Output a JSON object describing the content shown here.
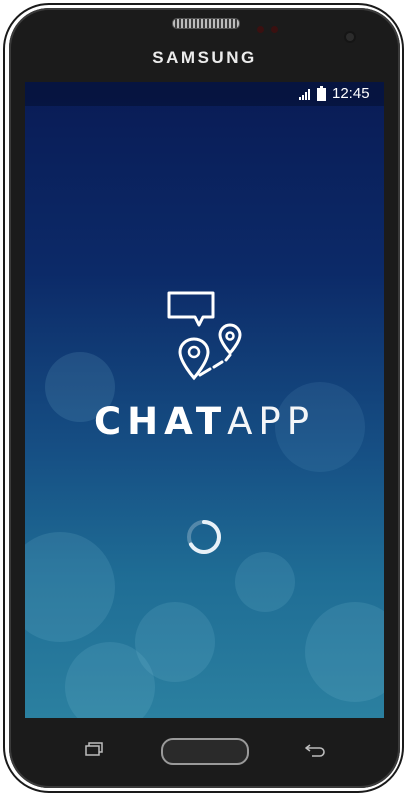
{
  "device": {
    "brand": "SAMSUNG"
  },
  "status_bar": {
    "time": "12:45",
    "icons": [
      "signal-icon",
      "battery-icon"
    ]
  },
  "splash": {
    "app_name_bold": "CHAT",
    "app_name_light": "APP",
    "logo_icon": "chat-location-logo-icon",
    "loading_icon": "loading-spinner-icon"
  },
  "nav_bar": {
    "icons": [
      "recent-apps-icon",
      "home-button",
      "back-icon"
    ]
  },
  "colors": {
    "screen_top": "#091b55",
    "screen_bottom": "#2b80a0",
    "text": "#ffffff"
  }
}
